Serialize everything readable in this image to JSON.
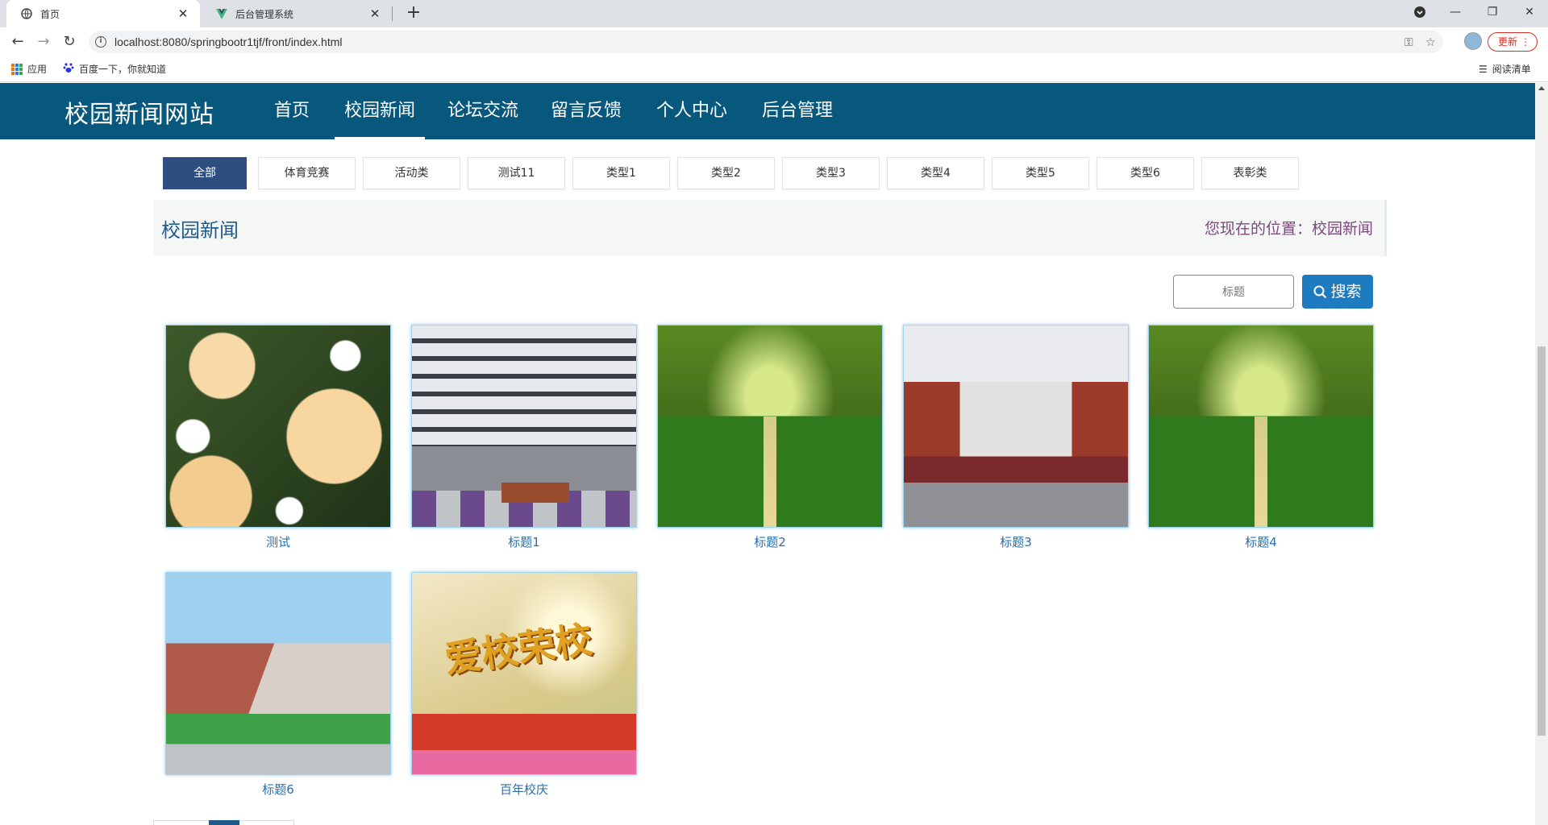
{
  "browser": {
    "tabs": [
      {
        "title": "首页",
        "active": true
      },
      {
        "title": "后台管理系统",
        "active": false
      }
    ],
    "new_tab_symbol": "+",
    "url": "localhost:8080/springbootr1tjf/front/index.html",
    "update_label": "更新",
    "bookmarks": [
      {
        "label": "应用",
        "icon": "apps-grid-icon"
      },
      {
        "label": "百度一下，你就知道",
        "icon": "baidu-paw-icon"
      }
    ],
    "reading_list_label": "阅读清单"
  },
  "site": {
    "brand": "校园新闻网站",
    "nav": [
      {
        "label": "首页",
        "active": false
      },
      {
        "label": "校园新闻",
        "active": true
      },
      {
        "label": "论坛交流",
        "active": false
      },
      {
        "label": "留言反馈",
        "active": false
      },
      {
        "label": "个人中心",
        "active": false
      },
      {
        "label": "后台管理",
        "active": false
      }
    ]
  },
  "categories": [
    "全部",
    "体育竞赛",
    "活动类",
    "测试11",
    "类型1",
    "类型2",
    "类型3",
    "类型4",
    "类型5",
    "类型6",
    "表彰类"
  ],
  "active_category": "全部",
  "title_bar": {
    "heading": "校园新闻",
    "location": "您现在的位置：校园新闻"
  },
  "search": {
    "placeholder": "标题",
    "button_label": "搜索"
  },
  "news": [
    {
      "title": "测试",
      "image": "roses"
    },
    {
      "title": "标题1",
      "image": "building"
    },
    {
      "title": "标题2",
      "image": "tree-path"
    },
    {
      "title": "标题3",
      "image": "campus"
    },
    {
      "title": "标题4",
      "image": "tree-path"
    },
    {
      "title": "标题6",
      "image": "curved-building"
    },
    {
      "title": "百年校庆",
      "image": "anniversary"
    }
  ],
  "anniversary_banner_text": "爱校荣校",
  "colors": {
    "nav_bg": "#08587e",
    "active_category": "#2e4d80",
    "search_button": "#1e7bbf",
    "caption": "#2a6fb0"
  }
}
